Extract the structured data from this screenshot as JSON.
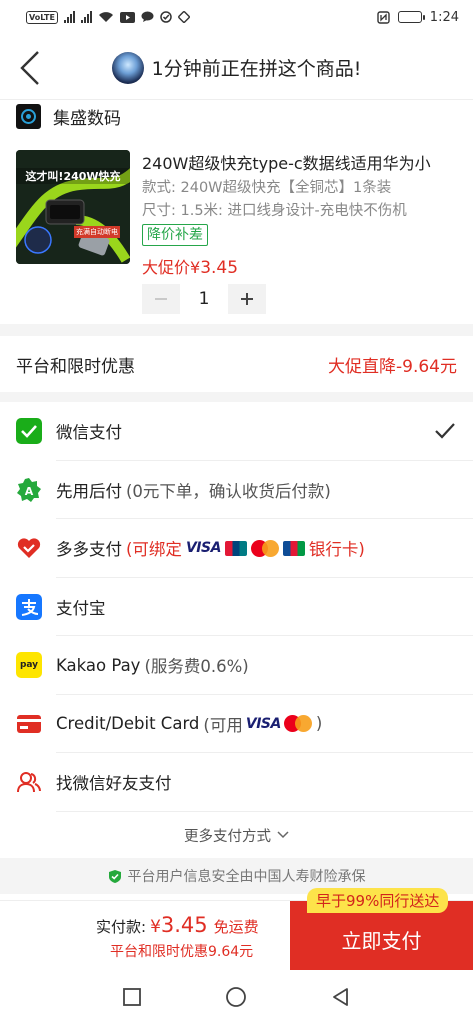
{
  "status_bar": {
    "time": "1:24",
    "volte": "VoLTE",
    "network": "1"
  },
  "header": {
    "title": "1分钟前正在拼这个商品!"
  },
  "store": {
    "name": "集盛数码"
  },
  "product": {
    "title": "240W超级快充type-c数据线适用华为小",
    "style": "款式: 240W超级快充【全铜芯】1条装",
    "size": "尺寸: 1.5米:  进口线身设计-充电快不伤机",
    "tag": "降价补差",
    "price_label": "大促价",
    "price_currency": "¥",
    "price_value": "3.45",
    "quantity": "1",
    "thumb_text": "这才叫!240W快充",
    "thumb_sub": "充满自动断电"
  },
  "discount": {
    "label": "平台和限时优惠",
    "value": "大促直降-9.64元"
  },
  "payments": [
    {
      "label": "微信支付",
      "icon": "wechat-pay-icon",
      "selected": true
    },
    {
      "label": "先用后付",
      "sub": "(0元下单，确认收货后付款)",
      "icon": "pay-later-icon"
    },
    {
      "label": "多多支付",
      "sub": "(可绑定",
      "sub_end": "银行卡)",
      "visa": "VISA",
      "icon": "duoduo-pay-icon"
    },
    {
      "label": "支付宝",
      "icon": "alipay-icon"
    },
    {
      "label": "Kakao Pay",
      "sub": "(服务费0.6%)",
      "icon": "kakao-pay-icon",
      "icon_text": "pay"
    },
    {
      "label": "Credit/Debit Card",
      "sub": "(可用",
      "sub_end": ")",
      "visa": "VISA",
      "icon": "credit-card-icon"
    },
    {
      "label": "找微信好友支付",
      "icon": "friends-pay-icon"
    }
  ],
  "more_payments": "更多支付方式",
  "insurance": "平台用户信息安全由中国人寿财险承保",
  "bottom": {
    "total_label": "实付款:",
    "total_currency": "¥",
    "total_value": "3.45",
    "shipping": "免运费",
    "discount_note": "平台和限时优惠9.64元",
    "pay_button": "立即支付",
    "badge": "早于99%同行送达"
  },
  "colors": {
    "accent": "#e02e24",
    "wechat": "#1aad19",
    "alipay": "#1677ff",
    "kakao": "#fee500"
  }
}
